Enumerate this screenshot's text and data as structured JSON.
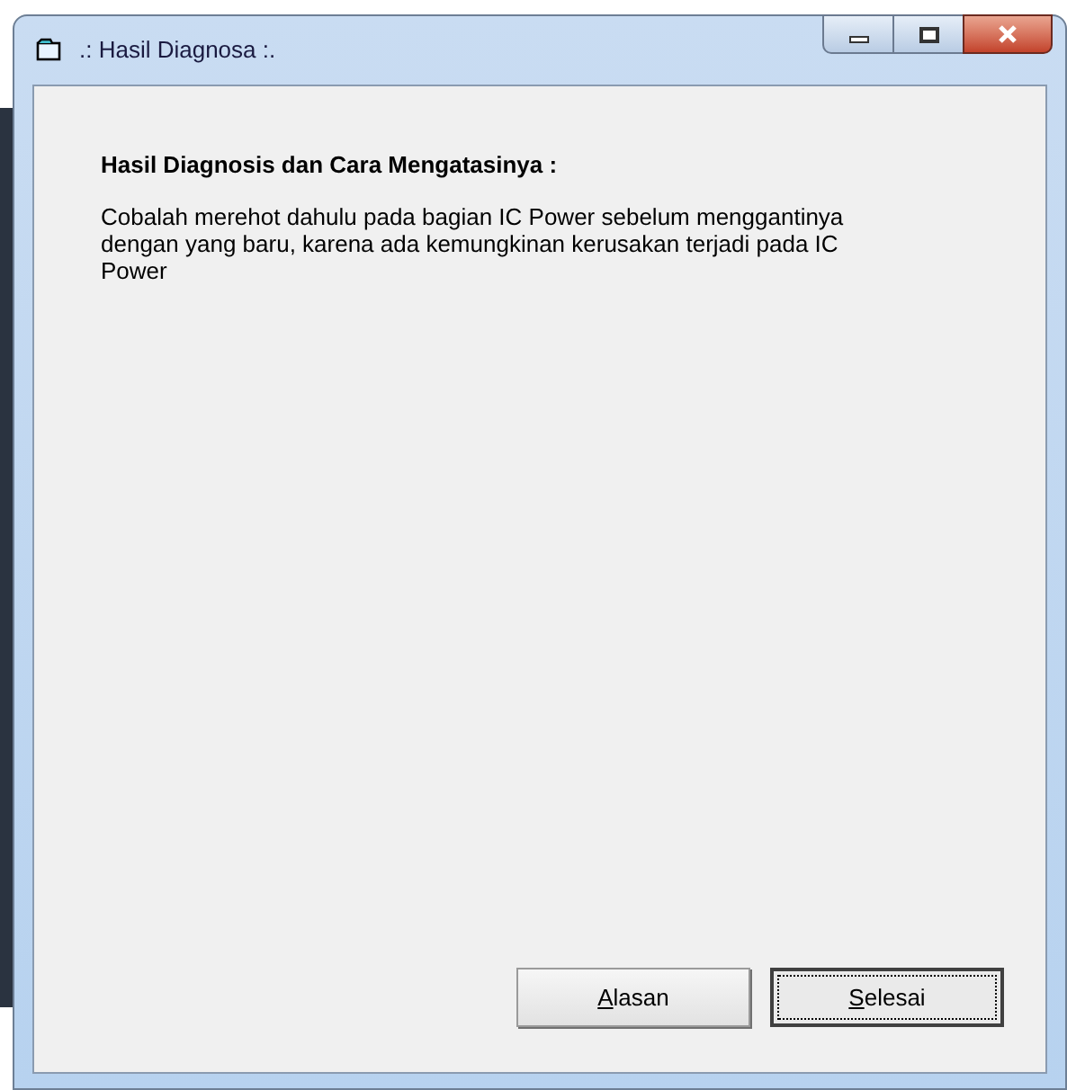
{
  "window": {
    "title": ".: Hasil Diagnosa :."
  },
  "heading": "Hasil Diagnosis dan Cara Mengatasinya :",
  "description": "Cobalah merehot dahulu pada bagian IC Power sebelum menggantinya dengan yang baru, karena ada kemungkinan kerusakan terjadi pada IC Power",
  "buttons": [
    {
      "label": "Alasan",
      "focused": false
    },
    {
      "label": "Selesai",
      "focused": true
    }
  ]
}
